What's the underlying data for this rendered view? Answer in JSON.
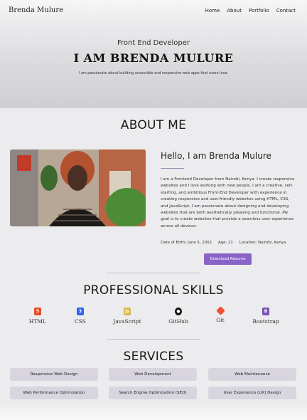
{
  "nav": {
    "brand": "Brenda Mulure",
    "links": [
      "Home",
      "About",
      "Portfolio",
      "Contact"
    ]
  },
  "hero": {
    "subtitle": "Front End Developer",
    "title": "I AM BRENDA MULURE",
    "tagline": "I am passionate about building accessible and responsive web apps that users love."
  },
  "about": {
    "heading": "ABOUT ME",
    "greeting": "Hello, I am Brenda Mulure",
    "bio": "I am a Frontend Developer from Nairobi, Kenya. I create responsive websites and I love working with new people. I am a creative, self-starting, and ambitious Front-End Developer with experience in creating responsive and user-friendly websites using HTML, CSS, and JavaScript. I am passionate about designing and developing websites that are both aesthetically pleasing and functional. My goal is to create websites that provide a seamless user experience across all devices.",
    "dob": "Date of Birth: June 5, 2002",
    "age": "Age: 21",
    "location": "Location: Nairobi, Kenya",
    "download_label": "Download Resume"
  },
  "skills": {
    "heading": "PROFESSIONAL SKILLS",
    "items": [
      {
        "label": "HTML",
        "icon": "html5-icon",
        "color": "#e44d26"
      },
      {
        "label": "CSS",
        "icon": "css3-icon",
        "color": "#2965f1"
      },
      {
        "label": "JavaScript",
        "icon": "js-icon",
        "color": "#d8b74a"
      },
      {
        "label": "GitHub",
        "icon": "github-icon",
        "color": "#111111"
      },
      {
        "label": "Git",
        "icon": "git-icon",
        "color": "#f05033"
      },
      {
        "label": "Bootstrap",
        "icon": "bootstrap-icon",
        "color": "#7952b3"
      }
    ]
  },
  "services": {
    "heading": "SERVICES",
    "items": [
      "Responsive Web Design",
      "Web Development",
      "Web Maintenance",
      "Web Performance Optimization",
      "Search Engine Optimization (SEO)",
      "User Experience (UX) Design"
    ]
  },
  "colors": {
    "accent": "#8a63c8",
    "service_bg": "#d8d5df"
  }
}
